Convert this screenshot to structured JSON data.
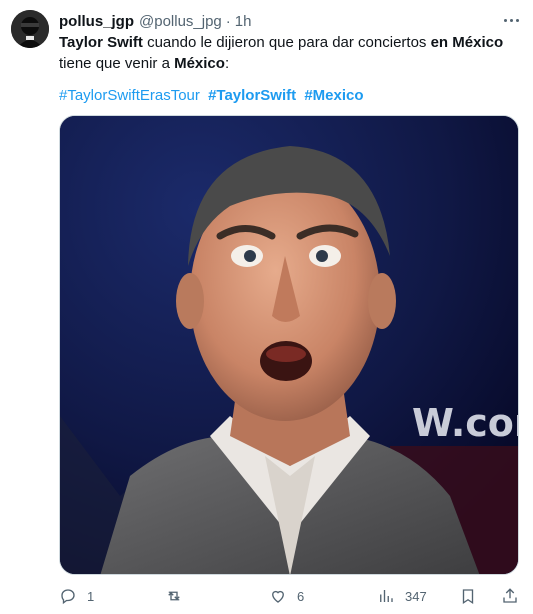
{
  "tweet": {
    "author_name": "pollus_jgp",
    "author_handle": "@pollus_jpg",
    "separator": "·",
    "time": "1h",
    "text_parts": {
      "p1": "Taylor Swift",
      "p2": " cuando le dijieron que para dar conciertos ",
      "p3": "en México",
      "p4": " tiene que venir a ",
      "p5": "México",
      "p6": ":"
    },
    "hashtags": [
      "#TaylorSwiftErasTour",
      "#TaylorSwift",
      "#Mexico"
    ],
    "media_watermark": "W.com"
  },
  "actions": {
    "reply_count": "1",
    "retweet_count": "",
    "like_count": "6",
    "views_count": "347"
  },
  "icons": {
    "more": "more-horizontal-icon",
    "reply": "reply-icon",
    "retweet": "retweet-icon",
    "like": "heart-icon",
    "views": "views-chart-icon",
    "bookmark": "bookmark-icon",
    "share": "share-icon"
  },
  "colors": {
    "link": "#1d9bf0",
    "text": "#0f1419",
    "muted": "#536471"
  }
}
